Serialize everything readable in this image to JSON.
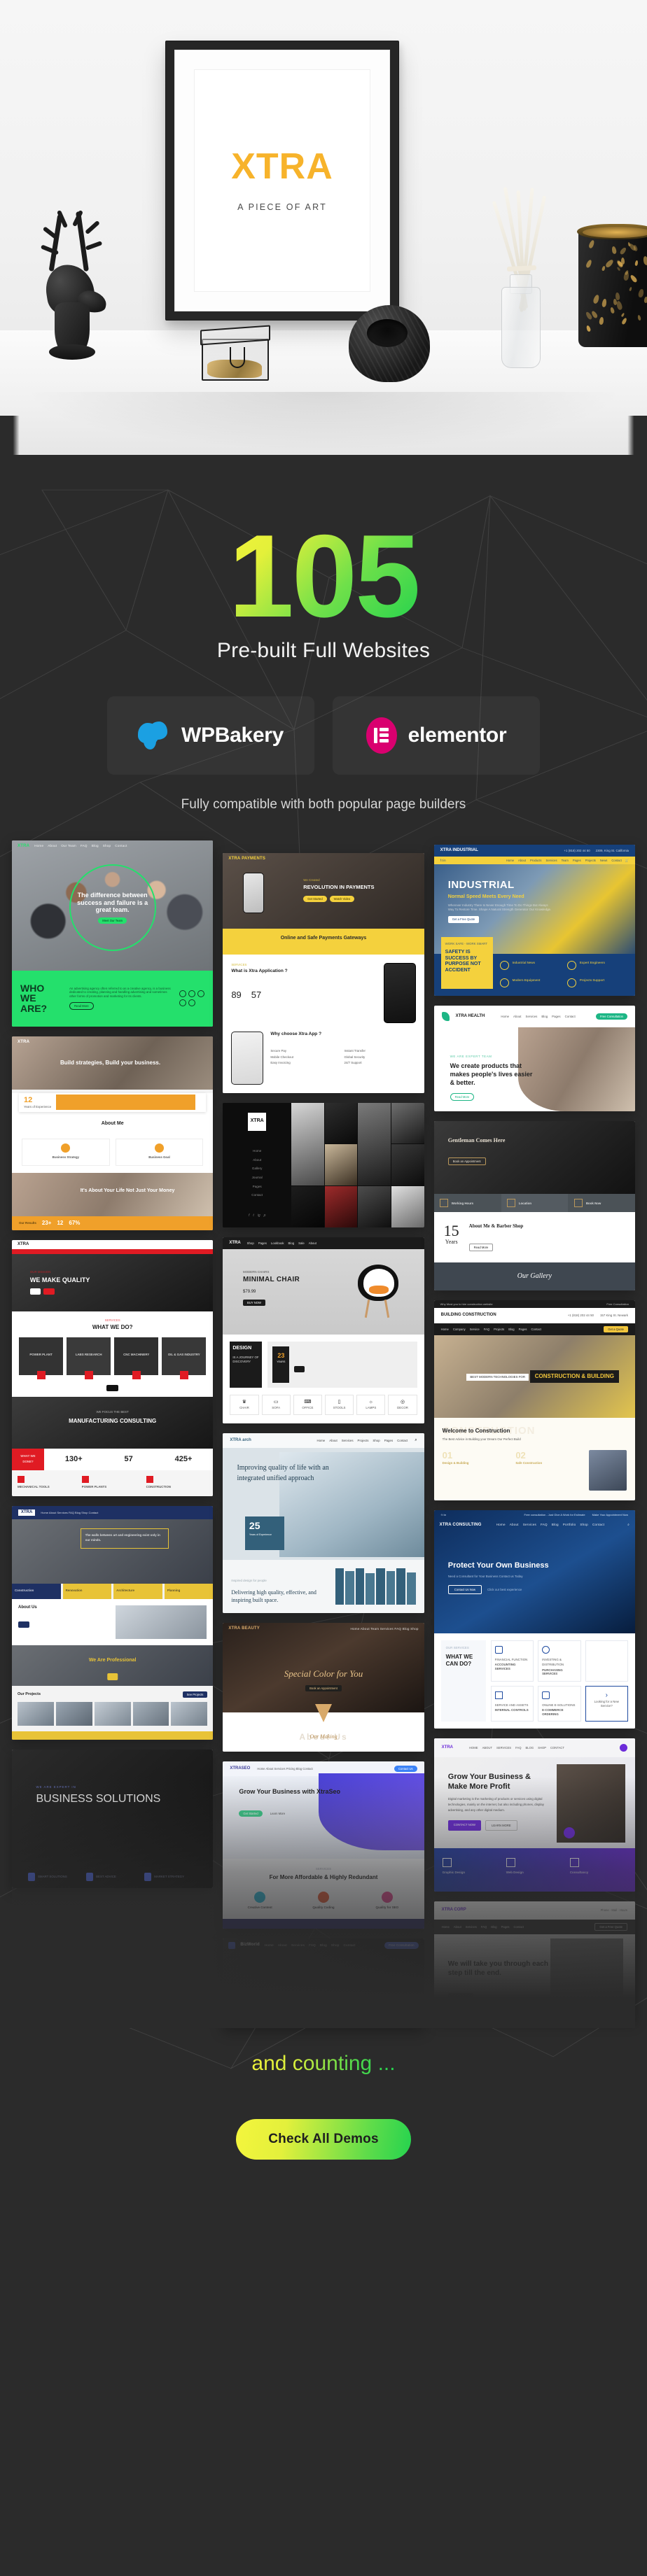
{
  "hero": {
    "poster_line1": "XTRA",
    "poster_subtitle": "A PIECE OF ART",
    "props": {
      "deer": "deer-figurine",
      "glass_box": "glass-trinket-box",
      "twine": "twine-ball",
      "vase": "reed-diffuser-vase",
      "lantern": "punched-metal-lantern"
    }
  },
  "headline": {
    "count": "105",
    "subtitle": "Pre-built Full Websites"
  },
  "builders": {
    "items": [
      {
        "name": "WPBakery",
        "icon": "wpbakery-logo-icon",
        "color": "#1ba0e2"
      },
      {
        "name": "elementor",
        "icon": "elementor-logo-icon",
        "color": "#d9006f"
      }
    ],
    "note": "Fully compatible with both popular page builders"
  },
  "demos": {
    "column1": [
      {
        "id": "agency-green",
        "accent": "#24e06c",
        "logo": "XTRA",
        "menu": [
          "Home",
          "About",
          "Our Team",
          "FAQ",
          "Blog",
          "Shop",
          "Contact"
        ],
        "hero_heading": "The difference between success and failure is a great team.",
        "hero_button": "Meet Our Team",
        "section_title": "WHO WE ARE?",
        "section_body": "An advertising agency often referred to as a creative agency, is a business dedicated to creating, planning and handling advertising and sometimes other forms of promotion and marketing for its clients.",
        "section_button": "Read More"
      },
      {
        "id": "financial-advisor",
        "accent": "#f0a02a",
        "logo": "XTRA",
        "hero_heading": "Build strategies, Build your business.",
        "stat_number": "12",
        "stat_label": "Years of Experience",
        "section_title": "About Me",
        "cards": [
          "Business Strategy",
          "Business Goal"
        ],
        "banner_heading": "It's About Your Life Not Just Your Money",
        "results_label": "Our Results",
        "results": [
          "23+",
          "12",
          "67%"
        ]
      },
      {
        "id": "manufacturing-red",
        "accent": "#e01b23",
        "logo": "XTRA",
        "eyebrow": "OUR MISSION",
        "hero_heading": "WE MAKE QUALITY",
        "section_eyebrow": "SERVICES",
        "section_title": "WHAT WE DO?",
        "service_cards": [
          "POWER PLANT",
          "LABS RESEARCH",
          "CNC MACHINERY",
          "OIL & GAS INDUSTRY"
        ],
        "banner_eyebrow": "WE FOCUS THE BEST",
        "banner_heading": "MANUFACTURING CONSULTING",
        "stat_box": "WHAT WE DONE?",
        "stats": [
          "130+",
          "57",
          "425+"
        ],
        "bottom_cards": [
          "MECHANICAL TOOLS",
          "POWER PLANTS",
          "CONSTRUCTION"
        ]
      },
      {
        "id": "engineering-navy",
        "accent": "#e8c337",
        "logo": "XTRA",
        "hero_quote": "The walls between art and engineering exist only in our minds.",
        "cards": [
          "Construction",
          "Renovation",
          "Architecture",
          "Planning"
        ],
        "about_title": "About Us",
        "pro_heading": "We Are Professional",
        "projects_title": "Our Projects",
        "projects_button": "See Projects"
      },
      {
        "id": "business-solutions-dark",
        "accent": "#4a63d8",
        "eyebrow": "WE ARE EXPERT IN",
        "hero_heading": "BUSINESS SOLUTIONS",
        "cards": [
          "SMART SOLUTIONS",
          "BEST ADVICE",
          "MARKET STRATEGY"
        ]
      }
    ],
    "column2": [
      {
        "id": "payments-app",
        "accent": "#f4d13d",
        "logo": "XTRA PAYMENTS",
        "hero_eyebrow": "We Created",
        "hero_heading": "REVOLUTION IN PAYMENTS",
        "buttons": [
          "Get Started",
          "Watch Video"
        ],
        "band_title": "Online and Safe Payments Gateways",
        "section_title": "What is Xtra Application ?",
        "stats": [
          "89",
          "57"
        ],
        "section2_title": "Why choose Xtra App ?",
        "features": [
          "Secure Pay",
          "Instant Transfer",
          "Mobile Checkout",
          "Global Security",
          "Easy Invoicing",
          "24/7 Support"
        ]
      },
      {
        "id": "fashion-portfolio",
        "accent": "#ffffff",
        "logo": "XTRA",
        "menu": [
          "Home",
          "About",
          "Gallery",
          "Journal",
          "Pages",
          "Contact"
        ],
        "social": [
          "facebook",
          "twitter",
          "instagram",
          "pinterest"
        ]
      },
      {
        "id": "furniture-shop",
        "accent": "#f0a02a",
        "logo": "XTRA",
        "menu": [
          "Shop",
          "Pages",
          "Lookbook",
          "Blog",
          "Sale",
          "About"
        ],
        "product_eyebrow": "MODERN CHAIRS",
        "product_name": "MINIMAL CHAIR",
        "product_price": "$79.99",
        "product_button": "BUY NOW",
        "promo_title": "DESIGN",
        "promo_sub": "IS A JOURNEY OF DISCOVERY",
        "years_number": "23",
        "years_label": "YEARS",
        "categories": [
          "CHAIR",
          "SOFA",
          "OFFICE",
          "STOOLS",
          "LAMPS",
          "DECOR"
        ]
      },
      {
        "id": "architecture",
        "accent": "#33607a",
        "logo": "XTRA arch",
        "menu": [
          "Home",
          "About",
          "Services",
          "Projects",
          "Shop",
          "Pages",
          "Contact"
        ],
        "hero_heading": "Improving quality of life with an integrated unified approach",
        "years_number": "25",
        "years_label": "Years of Experience",
        "footer_eyebrow": "Inspired design for people",
        "footer_heading": "Delivering high quality, effective, and inspiring built space."
      },
      {
        "id": "beauty-salon",
        "accent": "#d8a96a",
        "logo": "XTRA BEAUTY",
        "hero_heading": "Special Color for You",
        "hero_button": "Book an Appointment",
        "section_title": "About Us",
        "section_script": "Our Making"
      },
      {
        "id": "seo-agency",
        "accent": "#3b3b98",
        "logo": "XTRASEO",
        "button": "Contact Us",
        "hero_heading": "Grow Your Business with XtraSeo",
        "hero_buttons": [
          "Get Started",
          "Learn More"
        ],
        "mid_eyebrow": "SERVICES",
        "mid_heading": "For More Affordable & Highly Redundant",
        "cards": [
          "Creative Content",
          "Quality Coding",
          "Quality for SEO"
        ]
      },
      {
        "id": "bizworld-dark",
        "accent": "#4a63d8",
        "logo": "BizWorld",
        "menu": [
          "Home",
          "About",
          "Services",
          "FAQ",
          "Blog",
          "Shop",
          "Contact"
        ],
        "button": "Free Consultation"
      }
    ],
    "column3": [
      {
        "id": "industrial",
        "accent": "#f4d13d",
        "logo": "XTRA INDUSTRIAL",
        "phone": "+1 (818) 202 44 50",
        "address": "2309, King St. California",
        "menu": [
          "Home",
          "About",
          "Products",
          "Services",
          "Team",
          "Pages",
          "Projects",
          "News",
          "Contact"
        ],
        "hero_heading": "INDUSTRIAL",
        "hero_sub": "Normal Speed Meets Every Need",
        "hero_body": "Wherever Industry There Is Never Enough Time To Do Things But Always Way To Restore Time. Shape A Natural Strength Generator Our Knowledge.",
        "hero_button": "Get a Free Quote",
        "panel_eyebrow": "WORK SAFE - WORK SMART",
        "panel_heading": "SAFETY IS SUCCESS BY PURPOSE NOT ACCIDENT",
        "features": [
          "Industrial News",
          "Expert Engineers",
          "Modern Equipment",
          "Projects Support"
        ]
      },
      {
        "id": "medical-green",
        "accent": "#1db685",
        "logo": "XTRA HEALTH",
        "menu": [
          "Home",
          "About",
          "Services",
          "Blog",
          "Pages",
          "Contact"
        ],
        "button": "Free Consultation",
        "eyebrow": "WE ARE EXPERT TEAM",
        "heading": "We create products that makes people's lives easier & better.",
        "button2": "Read More"
      },
      {
        "id": "barber-shop",
        "accent": "#b9975b",
        "hero_heading": "Gentleman Comes Here",
        "hero_button": "Book an Appointment",
        "info_cards": [
          "Working Hours",
          "Location",
          "Book Now"
        ],
        "years_number": "15",
        "years_label": "Years",
        "about_title": "About Me & Barber Shop",
        "about_button": "Read More",
        "gallery_script": "Our Gallery"
      },
      {
        "id": "construction",
        "accent": "#f2c63c",
        "topbar": "Why Must you to hire construction website",
        "topbar_right": "Free Consultation",
        "logo": "BUILDING CONSTRUCTION",
        "phone": "+1 (818) 202 44 50",
        "address": "157 King St. Newark",
        "menu": [
          "Home",
          "Company",
          "Service",
          "FAQ",
          "Projects",
          "Blog",
          "Pages",
          "Contact"
        ],
        "button": "Get a Quote",
        "hero_eyebrow": "BEST MODERN TECHNOLOGIES FOR",
        "hero_heading": "CONSTRUCTION & BUILDING",
        "welcome_ghost": "CONSTRUCTION",
        "welcome_heading": "Welcome to Construction",
        "welcome_sub": "The Best Advice in Building your Dream Our Perfect Build",
        "steps": [
          "01",
          "02"
        ],
        "step_labels": [
          "Design & Building",
          "Safe Construction"
        ]
      },
      {
        "id": "consulting-blue",
        "accent": "#1f4ba0",
        "topbar_left": "Free consultation - Just Give A Work for Estimate",
        "topbar_right": "Make Your Appointment Now",
        "logo": "XTRA CONSULTING",
        "menu": [
          "Home",
          "About",
          "Services",
          "FAQ",
          "Blog",
          "Portfolio",
          "Shop",
          "Contact"
        ],
        "hero_heading": "Protect Your Own Business",
        "hero_sub": "Need a Consultant for Your Business Contact us Today",
        "hero_button": "Contact Us Now",
        "hero_link": "Click our best experience",
        "section_eyebrow": "OUR SERVICES",
        "section_title": "WHAT WE CAN DO?",
        "service_cards": [
          {
            "eyebrow": "FINANCIAL FUNCTION",
            "title": "ACCOUNTING SERVICES"
          },
          {
            "eyebrow": "INVESTING & DISTRIBUTION",
            "title": "PURCHASING SERVICES"
          },
          {
            "eyebrow": "SERVICE AND ASSETS",
            "title": "INTERNAL CONTROLS"
          },
          {
            "eyebrow": "ONLINE E-SOLUTIONS",
            "title": "E-COMMERCE ORDERING"
          }
        ],
        "more_card": "Looking for a New Service?"
      },
      {
        "id": "digital-purple",
        "accent": "#6c2bd9",
        "logo": "XTRA",
        "menu": [
          "HOME",
          "ABOUT",
          "SERVICES",
          "FAQ",
          "BLOG",
          "SHOP",
          "CONTACT"
        ],
        "hero_heading": "Grow Your Business & Make More Profit",
        "hero_body": "Digital marketing is the marketing of products or services using digital technologies, mainly on the internet, but also including phones, display advertising, and any other digital medium.",
        "hero_buttons": [
          "CONTACT NOW",
          "LEARN MORE"
        ],
        "service_cards": [
          "Graphic Design",
          "Web Design",
          "Consultancy"
        ]
      },
      {
        "id": "steps-light",
        "accent": "#6c2bd9",
        "logo": "XTRA CORP",
        "menu": [
          "Home",
          "About",
          "Services",
          "FAQ",
          "Blog",
          "Pages",
          "Contact"
        ],
        "button": "Get a Free Quote",
        "hero_heading": "We will take you through each step till the end.",
        "hero_button": "Contact Us"
      }
    ]
  },
  "footer": {
    "counting_text": "and counting ...",
    "cta_label": "Check All Demos"
  },
  "colors": {
    "background": "#2b2b2b",
    "gradient_start": "#f2f33a",
    "gradient_end": "#22d24e",
    "poster_accent": "#f7b32b"
  }
}
